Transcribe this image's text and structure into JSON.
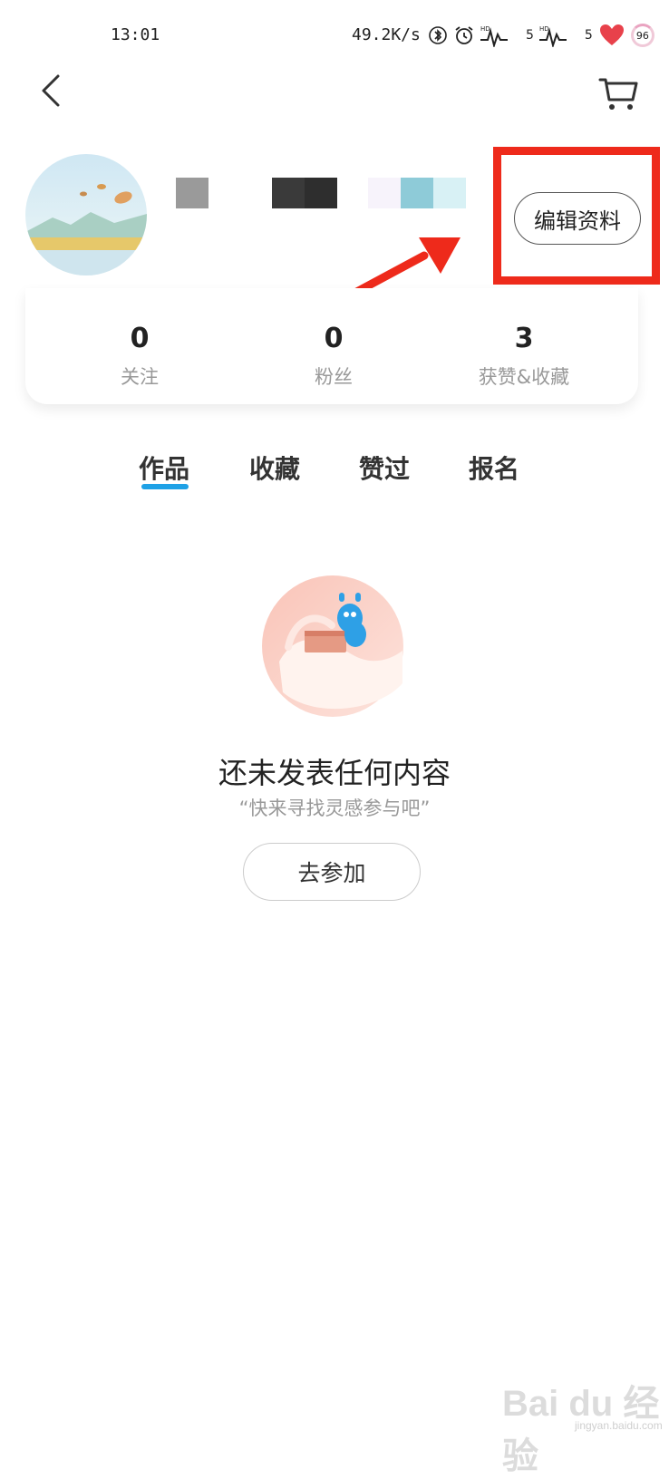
{
  "status_bar": {
    "time": "13:01",
    "network_speed": "49.2K/s",
    "signal1_label": "5",
    "signal2_label": "5",
    "battery": "96"
  },
  "header": {
    "back_icon": "chevron-left-icon",
    "cart_icon": "shopping-cart-icon"
  },
  "profile": {
    "edit_button": "编辑资料"
  },
  "stats": [
    {
      "value": "0",
      "label": "关注"
    },
    {
      "value": "0",
      "label": "粉丝"
    },
    {
      "value": "3",
      "label": "获赞&收藏"
    }
  ],
  "tabs": [
    {
      "label": "作品",
      "active": true
    },
    {
      "label": "收藏",
      "active": false
    },
    {
      "label": "赞过",
      "active": false
    },
    {
      "label": "报名",
      "active": false
    }
  ],
  "empty_state": {
    "title": "还未发表任何内容",
    "subtitle": "“快来寻找灵感参与吧”",
    "button": "去参加"
  },
  "watermark": {
    "text": "Bai du 经验",
    "sub": "jingyan.baidu.com"
  },
  "colors": {
    "accent": "#1ea1e6",
    "annotation_red": "#ee2a1b"
  }
}
